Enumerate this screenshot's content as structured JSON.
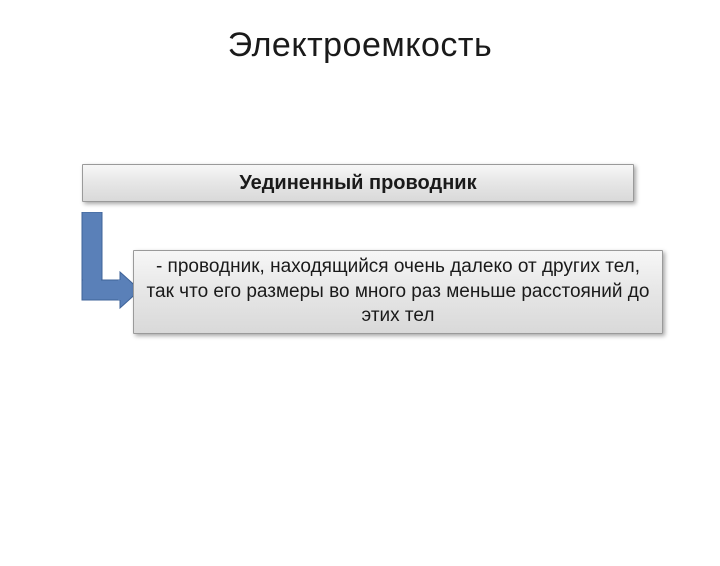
{
  "title": "Электроемкость",
  "heading": "Уединенный проводник",
  "body": "- проводник, находящийся очень далеко от других тел, так что его размеры во много раз меньше расстояний до этих тел",
  "arrow_color": "#5a80b8"
}
